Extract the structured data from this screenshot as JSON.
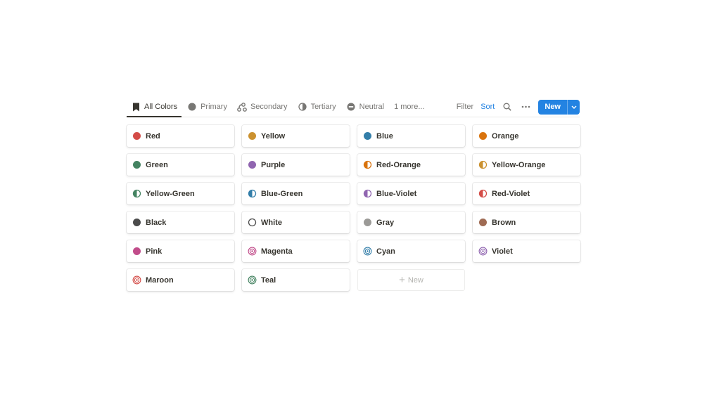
{
  "tabs": [
    {
      "label": "All Colors",
      "icon": "bookmark-icon",
      "active": true
    },
    {
      "label": "Primary",
      "icon": "circle-icon"
    },
    {
      "label": "Secondary",
      "icon": "nodes-icon"
    },
    {
      "label": "Tertiary",
      "icon": "half-circle-icon"
    },
    {
      "label": "Neutral",
      "icon": "minus-circle-icon"
    }
  ],
  "more_tabs": "1 more...",
  "actions": {
    "filter": "Filter",
    "sort": "Sort",
    "new": "New"
  },
  "colors_ui": {
    "accent": "#2383e2",
    "text": "#37352f",
    "muted": "#787774"
  },
  "cards": [
    {
      "label": "Red",
      "color": "#d44c47",
      "style": "solid"
    },
    {
      "label": "Yellow",
      "color": "#cb912f",
      "style": "solid"
    },
    {
      "label": "Blue",
      "color": "#337ea9",
      "style": "solid"
    },
    {
      "label": "Orange",
      "color": "#d9730d",
      "style": "solid"
    },
    {
      "label": "Green",
      "color": "#448361",
      "style": "solid"
    },
    {
      "label": "Purple",
      "color": "#9065b0",
      "style": "solid"
    },
    {
      "label": "Red-Orange",
      "color": "#d9730d",
      "style": "half"
    },
    {
      "label": "Yellow-Orange",
      "color": "#cb912f",
      "style": "half"
    },
    {
      "label": "Yellow-Green",
      "color": "#448361",
      "style": "half"
    },
    {
      "label": "Blue-Green",
      "color": "#337ea9",
      "style": "half"
    },
    {
      "label": "Blue-Violet",
      "color": "#9065b0",
      "style": "half"
    },
    {
      "label": "Red-Violet",
      "color": "#d44c47",
      "style": "half"
    },
    {
      "label": "Black",
      "color": "#4b4b4b",
      "style": "solid"
    },
    {
      "label": "White",
      "color": "#4b4b4b",
      "style": "ring"
    },
    {
      "label": "Gray",
      "color": "#9b9a97",
      "style": "solid"
    },
    {
      "label": "Brown",
      "color": "#9f6b53",
      "style": "solid"
    },
    {
      "label": "Pink",
      "color": "#c14c8a",
      "style": "solid"
    },
    {
      "label": "Magenta",
      "color": "#c14c8a",
      "style": "target"
    },
    {
      "label": "Cyan",
      "color": "#337ea9",
      "style": "target"
    },
    {
      "label": "Violet",
      "color": "#9065b0",
      "style": "target"
    },
    {
      "label": "Maroon",
      "color": "#d44c47",
      "style": "target"
    },
    {
      "label": "Teal",
      "color": "#448361",
      "style": "target"
    }
  ],
  "add_new": "New"
}
